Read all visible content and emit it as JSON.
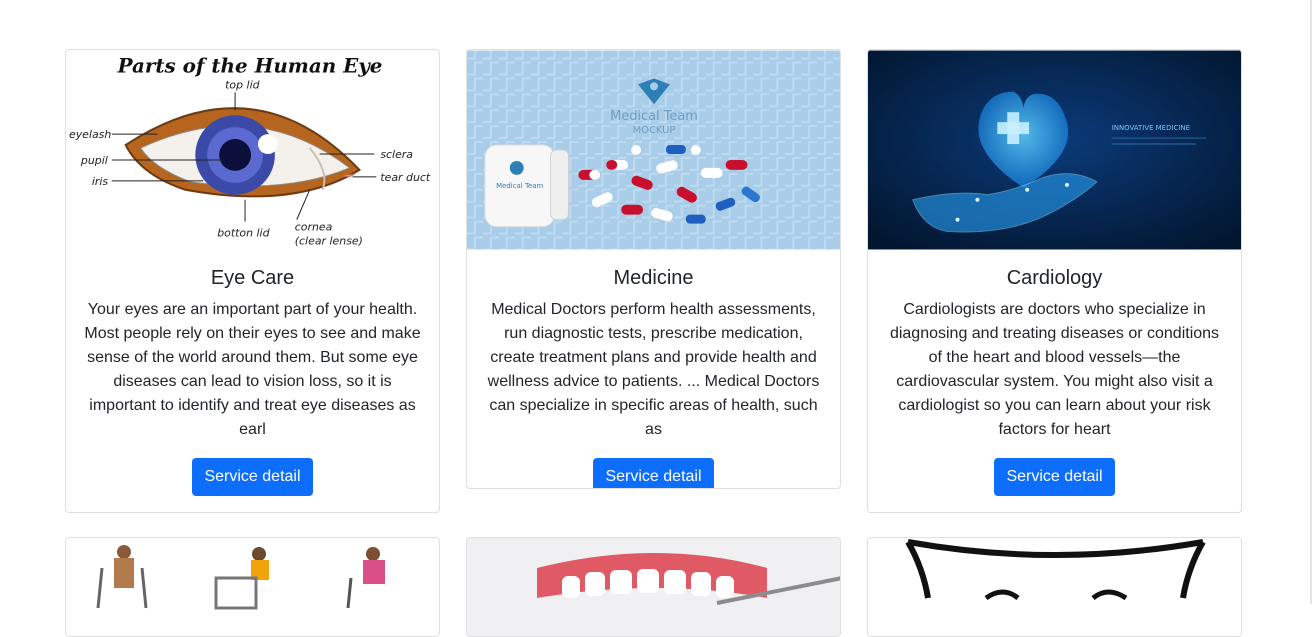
{
  "cards": [
    {
      "title": "Eye Care",
      "text": "Your eyes are an important part of your health. Most people rely on their eyes to see and make sense of the world around them. But some eye diseases can lead to vision loss, so it is important to identify and treat eye diseases as earl",
      "button": "Service detail",
      "image": {
        "heading": "Parts of the Human Eye",
        "labels": [
          "top lid",
          "eyelash",
          "pupil",
          "iris",
          "sclera",
          "tear duct",
          "botton lid",
          "cornea",
          "(clear lense)"
        ]
      }
    },
    {
      "title": "Medicine",
      "text": "Medical Doctors perform health assessments, run diagnostic tests, prescribe medication, create treatment plans and provide health and wellness advice to patients. ... Medical Doctors can specialize in specific areas of health, such as",
      "button": "Service detail",
      "image": {
        "brand": "Medical Team",
        "subbrand": "MOCKUP",
        "bottle_label": "Medical Team"
      }
    },
    {
      "title": "Cardiology",
      "text": "Cardiologists are doctors who specialize in diagnosing and treating diseases or conditions of the heart and blood vessels—the cardiovascular system. You might also visit a cardiologist so you can learn about your risk factors for heart",
      "button": "Service detail",
      "image": {
        "caption": "INNOVATIVE MEDICINE"
      }
    }
  ],
  "colors": {
    "primary": "#0d6efd",
    "border": "#dfdfdf",
    "text": "#212529"
  }
}
